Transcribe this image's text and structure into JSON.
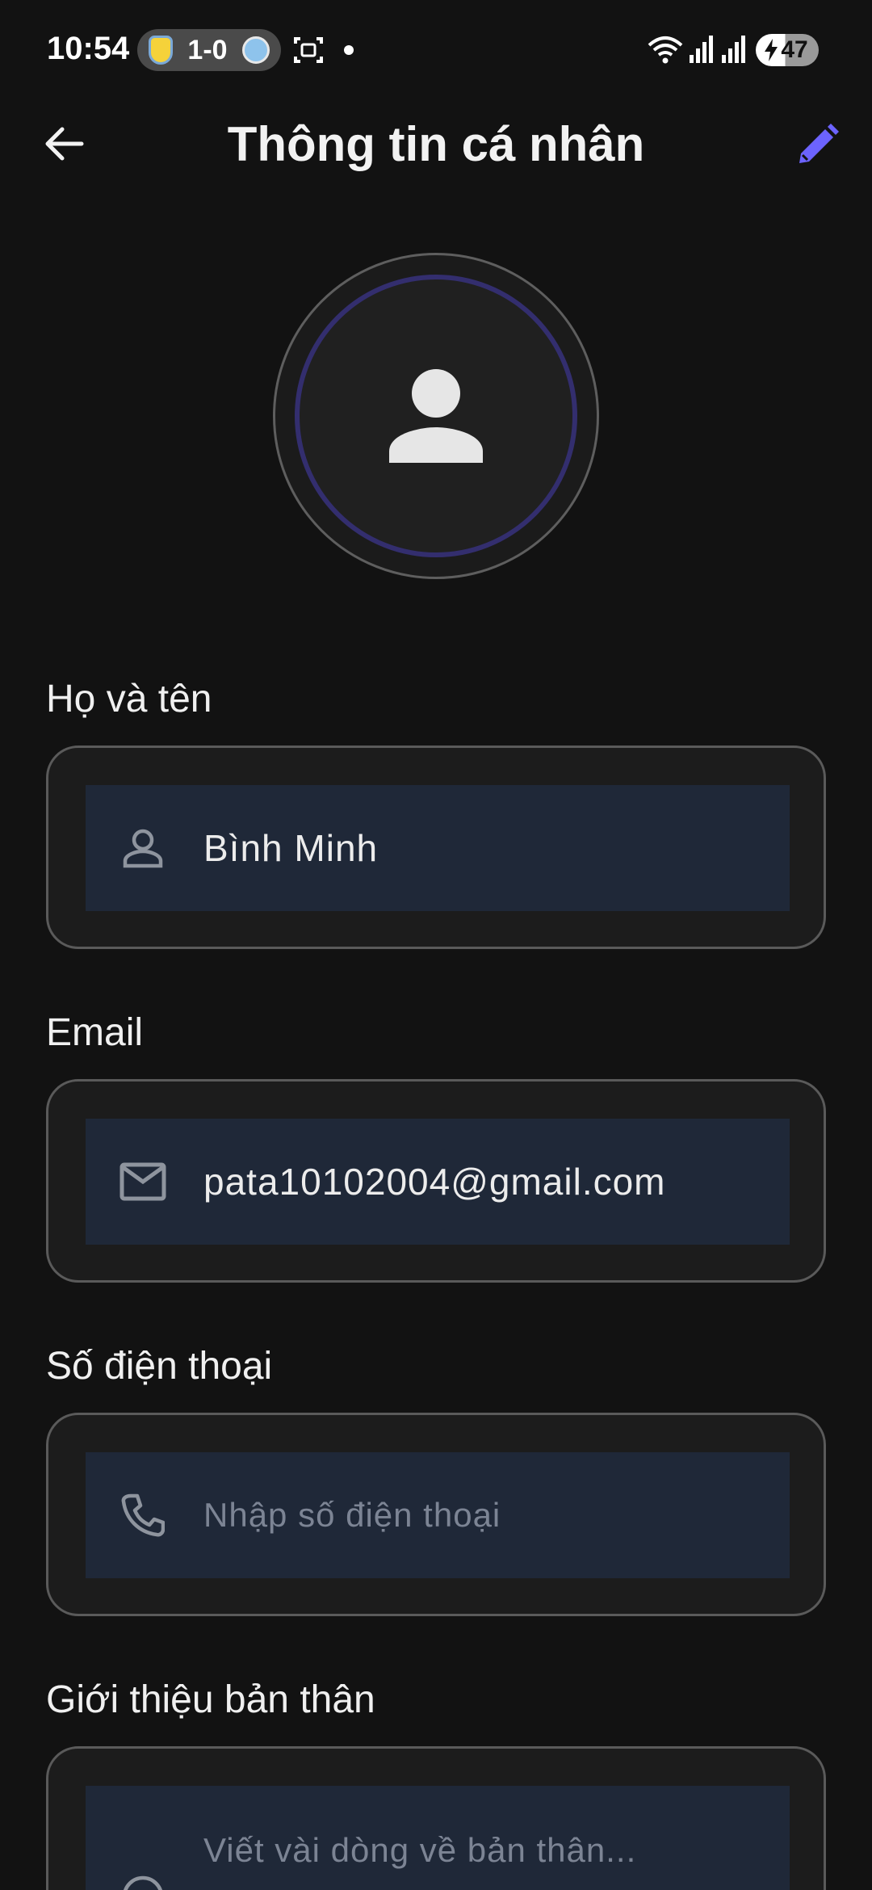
{
  "status_bar": {
    "time": "10:54",
    "score": "1-0",
    "battery": "47"
  },
  "header": {
    "title": "Thông tin cá nhân"
  },
  "form": {
    "name": {
      "label": "Họ và tên",
      "value": "Bình Minh"
    },
    "email": {
      "label": "Email",
      "value": "pata10102004@gmail.com"
    },
    "phone": {
      "label": "Số điện thoại",
      "placeholder": "Nhập số điện thoại"
    },
    "bio": {
      "label": "Giới thiệu bản thân",
      "placeholder": "Viết vài dòng về bản thân..."
    }
  },
  "colors": {
    "background": "#121212",
    "accent": "#6c63ff",
    "input_fill": "#1f2838",
    "avatar_ring": "#332e6e"
  },
  "icons": [
    "back-arrow-icon",
    "edit-pencil-icon",
    "person-icon",
    "email-icon",
    "phone-icon",
    "info-icon"
  ]
}
